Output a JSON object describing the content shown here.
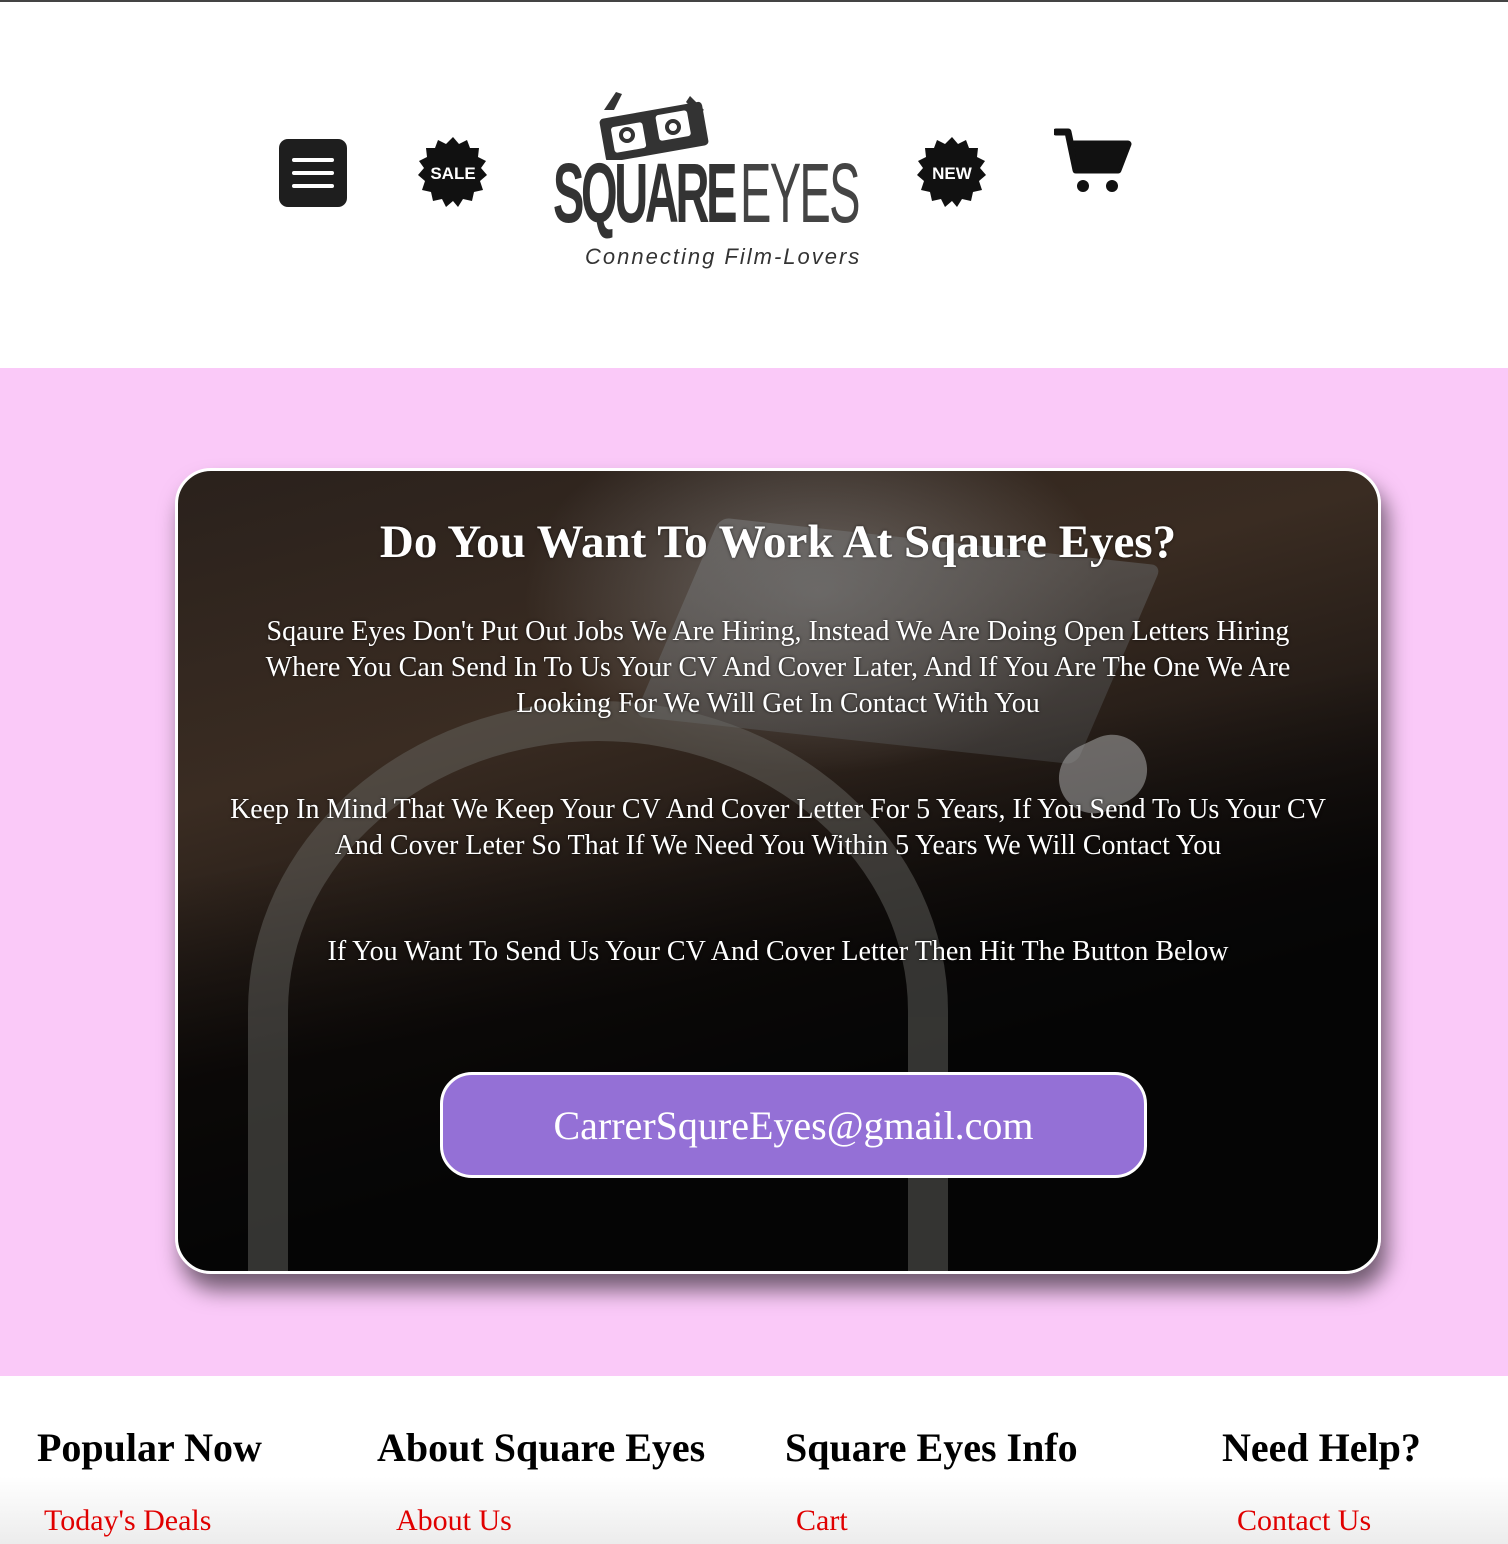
{
  "header": {
    "menu_icon": "hamburger-menu-icon",
    "sale_badge": "SALE",
    "new_badge": "NEW",
    "logo": {
      "word_bold": "SQUARE",
      "word_light": "EYES",
      "tagline": "Connecting Film-Lovers",
      "icon": "glasses-icon"
    },
    "cart_icon": "cart-icon"
  },
  "main": {
    "title": "Do You Want To Work At Sqaure Eyes?",
    "paragraph1": "Sqaure Eyes Don't Put Out Jobs We Are Hiring, Instead We Are Doing Open Letters Hiring Where You Can Send In To Us Your CV And Cover Later, And If You Are The One We Are Looking For We Will Get In Contact With You",
    "paragraph2": "Keep In Mind That We Keep Your CV And Cover Letter For 5 Years, If You Send To Us Your CV And Cover Leter So That If We Need You Within 5 Years We Will Contact You",
    "paragraph3": "If You Want To Send Us Your CV And Cover Letter Then Hit The Button Below",
    "email_button": "CarrerSqureEyes@gmail.com"
  },
  "footer": {
    "columns": [
      {
        "heading": "Popular Now",
        "link": "Today's Deals"
      },
      {
        "heading": "About Square Eyes",
        "link": "About Us"
      },
      {
        "heading": "Square Eyes Info",
        "link": "Cart"
      },
      {
        "heading": "Need Help?",
        "link": "Contact Us"
      }
    ]
  },
  "colors": {
    "page_background": "#fac9f8",
    "button": "#9470d6",
    "footer_link": "#e00000",
    "logo_text": "#333333"
  }
}
